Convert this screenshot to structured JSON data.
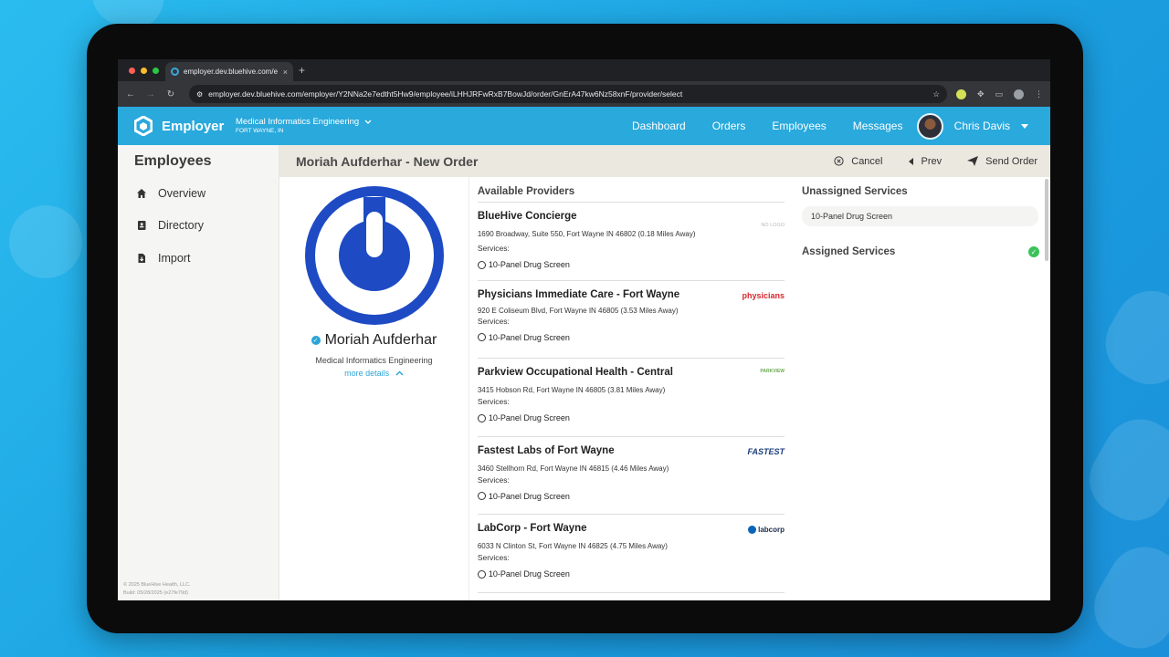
{
  "browser": {
    "tab_title": "employer.dev.bluehive.com/e",
    "tab_close": "×",
    "new_tab": "+",
    "url": "employer.dev.bluehive.com/employer/Y2NNa2e7edtht5Hw9/employee/iLHHJRFwRxB7BowJd/order/GnErA47kw6Nz58xnF/provider/select",
    "back_icon": "←",
    "forward_icon": "→",
    "reload_icon": "↻",
    "star_icon": "☆"
  },
  "header": {
    "app_name": "Employer",
    "org_name": "Medical Informatics Engineering",
    "org_location": "FORT WAYNE, IN",
    "nav": [
      "Dashboard",
      "Orders",
      "Employees",
      "Messages"
    ],
    "user_name": "Chris Davis"
  },
  "sidebar": {
    "title": "Employees",
    "items": [
      {
        "label": "Overview",
        "icon": "home-icon"
      },
      {
        "label": "Directory",
        "icon": "contact-book-icon"
      },
      {
        "label": "Import",
        "icon": "file-import-icon"
      }
    ],
    "footer_line1": "© 2025 BlueHive Health, LLC.",
    "footer_line2": "Build: 05/28/2025 (e27fe79d)"
  },
  "page": {
    "title": "Moriah Aufderhar - New Order",
    "actions": {
      "cancel": "Cancel",
      "prev": "Prev",
      "send": "Send Order"
    }
  },
  "profile": {
    "name": "Moriah Aufderhar",
    "org": "Medical Informatics Engineering",
    "more": "more details"
  },
  "providers": {
    "title": "Available Providers",
    "services_label": "Services:",
    "list": [
      {
        "name": "BlueHive Concierge",
        "address": "1690 Broadway, Suite 550, Fort Wayne IN 46802 (0.18 Miles Away)",
        "service": "10-Panel Drug Screen",
        "logo": "NO LOGO"
      },
      {
        "name": "Physicians Immediate Care - Fort Wayne",
        "address": "920 E Coliseum Blvd, Fort Wayne IN 46805 (3.53 Miles Away)",
        "service": "10-Panel Drug Screen",
        "logo": "physicians"
      },
      {
        "name": "Parkview Occupational Health - Central",
        "address": "3415 Hobson Rd, Fort Wayne IN 46805 (3.81 Miles Away)",
        "service": "10-Panel Drug Screen",
        "logo": "PARKVIEW"
      },
      {
        "name": "Fastest Labs of Fort Wayne",
        "address": "3460 Stellhorn Rd, Fort Wayne IN 46815 (4.46 Miles Away)",
        "service": "10-Panel Drug Screen",
        "logo": "FASTEST"
      },
      {
        "name": "LabCorp - Fort Wayne",
        "address": "6033 N Clinton St, Fort Wayne IN 46825 (4.75 Miles Away)",
        "service": "10-Panel Drug Screen",
        "logo": "labcorp"
      }
    ]
  },
  "services": {
    "unassigned_title": "Unassigned Services",
    "unassigned": [
      "10-Panel Drug Screen"
    ],
    "assigned_title": "Assigned Services"
  },
  "colors": {
    "brand": "#29a9dc",
    "avatar": "#1e4bc4",
    "check": "#3bc25a"
  }
}
